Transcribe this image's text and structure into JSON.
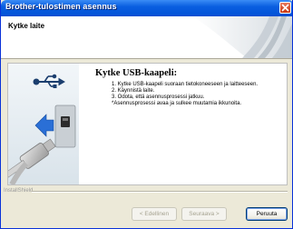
{
  "window": {
    "title": "Brother-tulostimen asennus"
  },
  "header": {
    "title": "Kytke laite"
  },
  "content": {
    "heading": "Kytke USB-kaapeli:",
    "steps": [
      "1. Kytke USB-kaapeli suoraan tietokoneeseen ja laitteeseen.",
      "2. Käynnistä laite.",
      "3. Odota, että asennusprosessi jatkuu.",
      "*Asennusprosessi avaa ja sulkee muutamia ikkunoita."
    ]
  },
  "footer": {
    "installshield_label": "InstallShield",
    "back_label": "< Edellinen",
    "next_label": "Seuraava >",
    "cancel_label": "Peruuta"
  },
  "colors": {
    "titlebar": "#0A5FE0",
    "close_button": "#C7350F",
    "arrow_blue": "#2A6FD6",
    "usb_symbol": "#1B3E6E"
  }
}
